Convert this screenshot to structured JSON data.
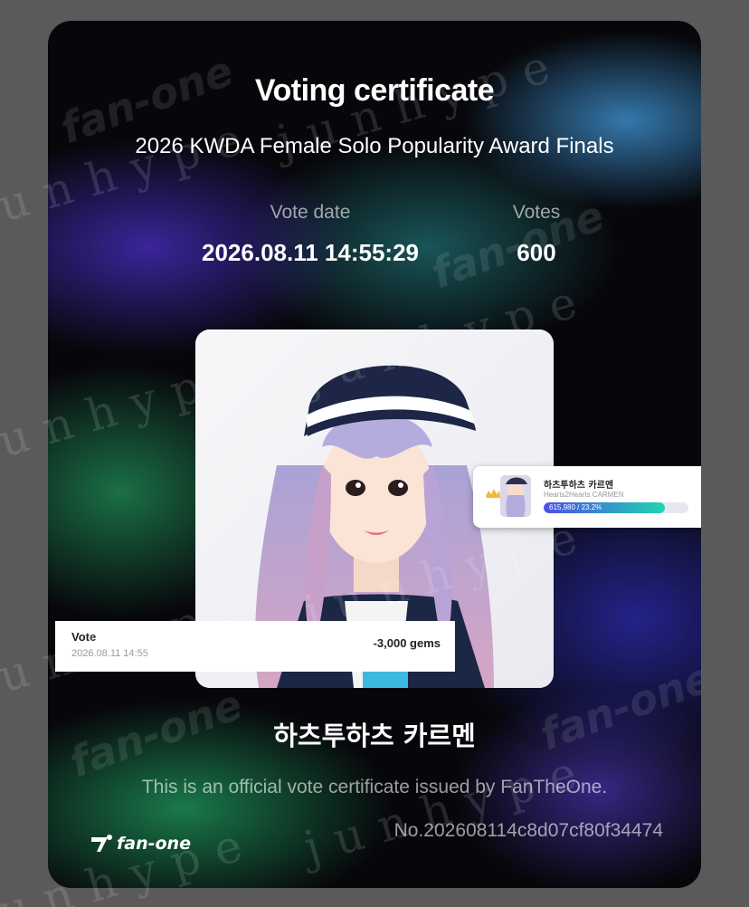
{
  "certificate": {
    "title": "Voting certificate",
    "subtitle": "2026 KWDA Female Solo Popularity Award Finals",
    "vote_date_label": "Vote date",
    "vote_date_value": "2026.08.11 14:55:29",
    "votes_label": "Votes",
    "votes_value": "600",
    "artist_name": "하츠투하츠 카르멘",
    "issued_text": "This is an official vote certificate issued by FanTheOne.",
    "serial_number": "No.202608114c8d07cf80f34474",
    "brand_name": "fan-one",
    "photo_icon": "artist-photo"
  },
  "ranking_card": {
    "name_ko": "하츠투하츠 카르멘",
    "name_en": "Hearts2Hearts CARMEN",
    "progress_text": "615,980 / 23.2%",
    "progress_fraction": 0.84,
    "crown_icon": "crown-icon",
    "logo_icon": "fanone-logo-icon"
  },
  "gem_receipt": {
    "label": "Vote",
    "date": "2026.08.11 14:55",
    "amount": "-3,000 gems"
  },
  "watermark": {
    "text": "junhype"
  },
  "colors": {
    "progress_start": "#4a4ee8",
    "progress_end": "#1fd6b0",
    "card_background": "#07070b"
  }
}
